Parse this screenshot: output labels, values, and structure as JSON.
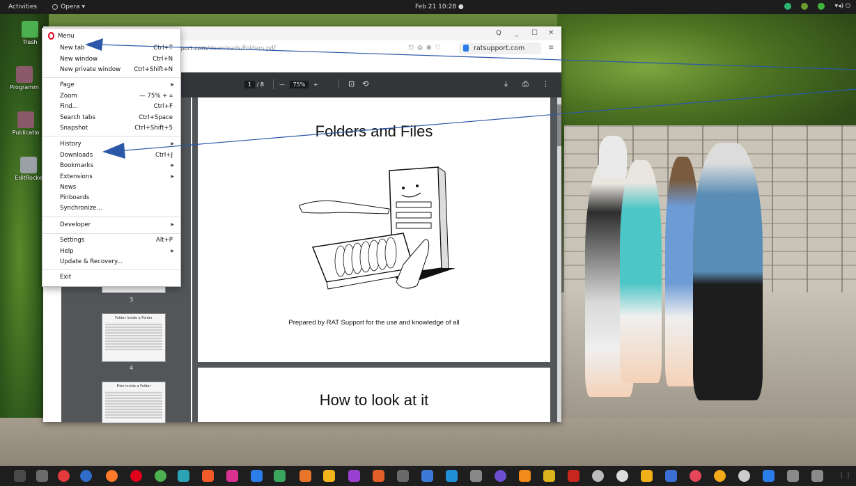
{
  "topbar": {
    "activities": "Activities",
    "app": "Opera ▾",
    "clock": "Feb 21  10:28  ●"
  },
  "desktop_icons": [
    {
      "label": "Trash"
    },
    {
      "label": "Programm"
    },
    {
      "label": "Publicatio"
    },
    {
      "label": "EditRocke"
    }
  ],
  "browser": {
    "url_host": "port.com",
    "url_path": "/downloads/Folders.pdf",
    "search_text": "ratsupport.com",
    "window_controls": [
      "Q",
      "_",
      "☐",
      "✕"
    ]
  },
  "pdf_toolbar": {
    "page_current": "1",
    "page_total": "/ 8",
    "zoom_minus": "—",
    "zoom": "75%",
    "zoom_plus": "+"
  },
  "thumbnails": [
    {
      "num": "3",
      "title": ""
    },
    {
      "num": "4",
      "title": "Folder inside a Folder"
    },
    {
      "num": "",
      "title": "Files inside a Folder"
    }
  ],
  "pdf": {
    "page1_title": "Folders and Files",
    "page1_subtitle": "Prepared by RAT Support for the use and knowledge of all",
    "page2_title": "How to look at it"
  },
  "menu": {
    "title": "Menu",
    "items": [
      {
        "label": "New tab",
        "shortcut": "Ctrl+T"
      },
      {
        "label": "New window",
        "shortcut": "Ctrl+N"
      },
      {
        "label": "New private window",
        "shortcut": "Ctrl+Shift+N"
      },
      {
        "label": "Page",
        "shortcut": ""
      },
      {
        "label": "Zoom",
        "shortcut": "—  75%  +  ⌗"
      },
      {
        "label": "Find...",
        "shortcut": "Ctrl+F"
      },
      {
        "label": "Search tabs",
        "shortcut": "Ctrl+Space"
      },
      {
        "label": "Snapshot",
        "shortcut": "Ctrl+Shift+5"
      },
      {
        "label": "History",
        "shortcut": ""
      },
      {
        "label": "Downloads",
        "shortcut": "Ctrl+J"
      },
      {
        "label": "Bookmarks",
        "shortcut": ""
      },
      {
        "label": "Extensions",
        "shortcut": ""
      },
      {
        "label": "News",
        "shortcut": ""
      },
      {
        "label": "Pinboards",
        "shortcut": ""
      },
      {
        "label": "Synchronize...",
        "shortcut": ""
      },
      {
        "label": "Developer",
        "shortcut": ""
      },
      {
        "label": "Settings",
        "shortcut": "Alt+P"
      },
      {
        "label": "Help",
        "shortcut": ""
      },
      {
        "label": "Update & Recovery...",
        "shortcut": ""
      },
      {
        "label": "Exit",
        "shortcut": ""
      }
    ]
  },
  "colors": {
    "opera_red": "#e0001a",
    "pdf_toolbar": "#323639",
    "pdf_side": "#525659",
    "arrow": "#2a57a8",
    "dock": "#1e1e1e"
  }
}
